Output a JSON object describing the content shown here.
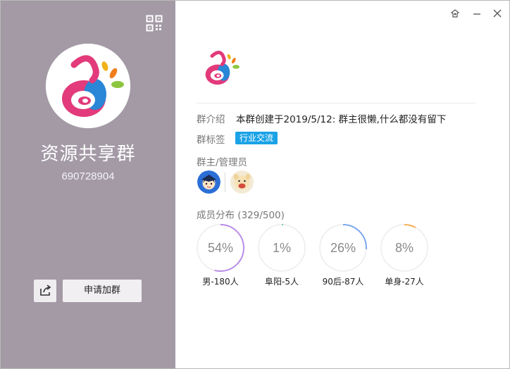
{
  "left": {
    "group_name": "资源共享群",
    "group_id": "690728904",
    "join_label": "申请加群"
  },
  "info": {
    "intro_label": "群介绍",
    "intro_value": "本群创建于2019/5/12:  群主很懒,什么都没有留下",
    "tags_label": "群标签",
    "tag": "行业交流",
    "admins_label": "群主/管理员",
    "members_label": "成员分布",
    "members_count": "(329/500)"
  },
  "stats": [
    {
      "value": "54%",
      "fraction": 0.54,
      "caption": "男-180人",
      "color": "#b98de8"
    },
    {
      "value": "1%",
      "fraction": 0.01,
      "caption": "阜阳-5人",
      "color": "#7ac7a8"
    },
    {
      "value": "26%",
      "fraction": 0.26,
      "caption": "90后-87人",
      "color": "#7aa7ee"
    },
    {
      "value": "8%",
      "fraction": 0.08,
      "caption": "单身-27人",
      "color": "#f5b15a"
    }
  ],
  "icons": [
    "qr-code-icon",
    "share-icon",
    "skin-icon",
    "minimize-icon",
    "close-icon"
  ]
}
